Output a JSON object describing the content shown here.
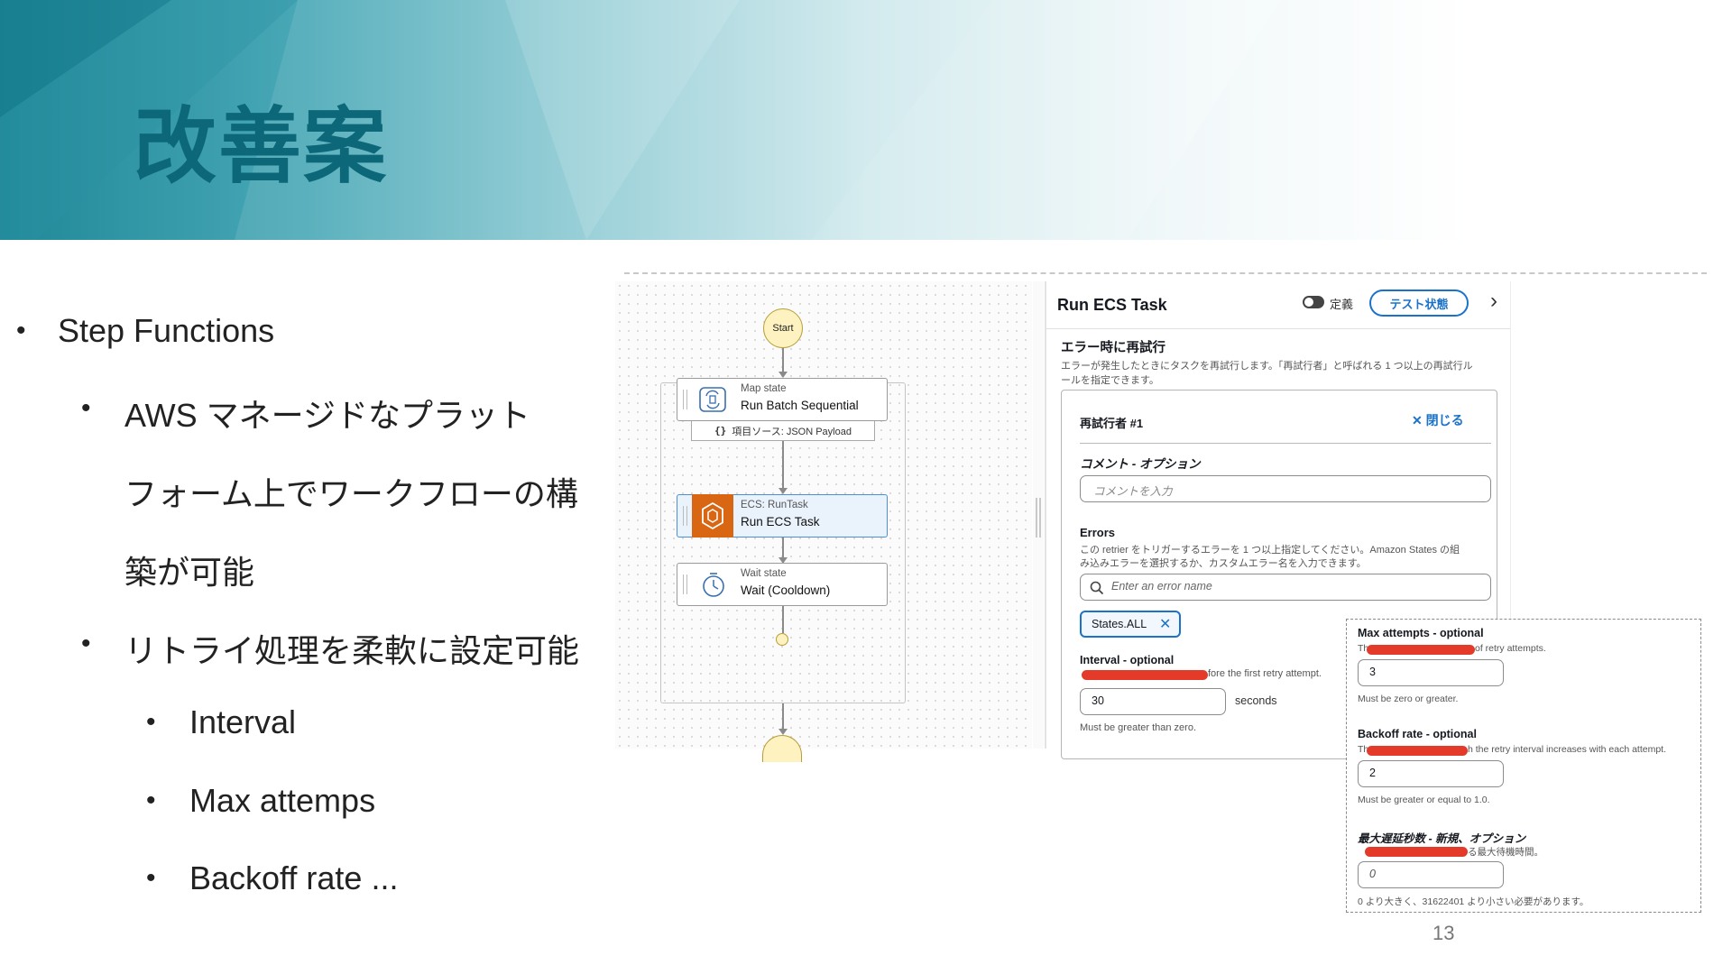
{
  "slide": {
    "title": "改善案",
    "page_number": "13",
    "bullets": {
      "l1": "Step Functions",
      "l2a_1": "AWS マネージドなプラット",
      "l2a_2": "フォーム上でワークフローの構",
      "l2a_3": "築が可能",
      "l2b": "リトライ処理を柔軟に設定可能",
      "l3a": "Interval",
      "l3b": "Max attemps",
      "l3c": "Backoff rate ..."
    }
  },
  "workflow": {
    "start": "Start",
    "map_node": {
      "type": "Map state",
      "name": "Run Batch Sequential",
      "source": "項目ソース: JSON Payload",
      "source_icon": "{}"
    },
    "ecs_node": {
      "type": "ECS: RunTask",
      "name": "Run ECS Task"
    },
    "wait_node": {
      "type": "Wait state",
      "name": "Wait (Cooldown)"
    }
  },
  "panel": {
    "title": "Run ECS Task",
    "toggle_label": "定義",
    "test_button": "テスト状態",
    "chevron": "›",
    "section_title": "エラー時に再試行",
    "section_desc_1": "エラーが発生したときにタスクを再試行します。「再試行者」と呼ばれる 1 つ以上の再試行ル",
    "section_desc_2": "ールを指定できます。",
    "retrier": {
      "title": "再試行者 #1",
      "close": "閉じる",
      "comment_label": "コメント - オプション",
      "comment_placeholder": "コメントを入力",
      "errors_label": "Errors",
      "errors_desc_1": "この retrier をトリガーするエラーを 1 つ以上指定してください。Amazon States の組",
      "errors_desc_2": "み込みエラーを選択するか、カスタムエラー名を入力できます。",
      "error_search_placeholder": "Enter an error name",
      "error_token": "States.ALL",
      "interval_label": "Interval - optional",
      "interval_hint": "fore the first retry attempt.",
      "interval_value": "30",
      "interval_unit": "seconds",
      "interval_help": "Must be greater than zero."
    }
  },
  "detail": {
    "max_attempts_label": "Max attempts - optional",
    "max_attempts_hint_pre": "Th",
    "max_attempts_hint": "of retry attempts.",
    "max_attempts_value": "3",
    "max_attempts_help": "Must be zero or greater.",
    "backoff_label": "Backoff rate - optional",
    "backoff_hint_pre": "Th",
    "backoff_hint": "h the retry interval increases with each attempt.",
    "backoff_value": "2",
    "backoff_help": "Must be greater or equal to 1.0.",
    "maxdelay_label": "最大遅延秒数 - 新規、オプション",
    "maxdelay_hint": "る最大待機時間。",
    "maxdelay_value": "0",
    "maxdelay_help": "0 より大きく、31622401 より小さい必要があります。"
  },
  "colors": {
    "title": "#0c6878",
    "accent_blue": "#1a73c9",
    "ecs_orange": "#d86613",
    "redaction": "#e33a2a"
  }
}
